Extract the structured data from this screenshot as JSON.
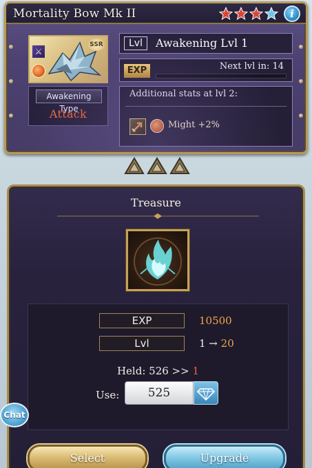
{
  "weapon": {
    "name": "Mortality Bow Mk II",
    "stars": [
      "red",
      "red",
      "red",
      "blue"
    ],
    "star_colors": {
      "red": "#d9473b",
      "blue": "#6fc3ec"
    },
    "info_label": "i",
    "element_badge": "⚔",
    "rarity": "SSR",
    "awakening_type_label": "Awakening Type",
    "awakening_type_value": "Attack",
    "lvl_tag": "Lvl",
    "lvl_value": "Awakening Lvl 1",
    "exp_tag": "EXP",
    "next_lvl": "Next lvl in: 14",
    "exp_progress": 0,
    "stats_title": "Additional stats at lvl 2:",
    "stat_line": "Might +2%"
  },
  "treasure": {
    "title": "Treasure",
    "exp_label": "EXP",
    "exp_value": "10500",
    "lvl_label": "Lvl",
    "lvl_from": "1 →",
    "lvl_to": "20",
    "held_prefix": "Held: 526 >>",
    "held_after": "1",
    "use_label": "Use:",
    "use_value": "525"
  },
  "chat_label": "Chat",
  "buttons": {
    "select": "Select",
    "upgrade": "Upgrade"
  },
  "colors": {
    "gold_frame": "#b79a5c",
    "attack_red": "#f06a3a",
    "orange_value": "#f2a64a",
    "upgrade_blue": "#4f9fc6"
  }
}
